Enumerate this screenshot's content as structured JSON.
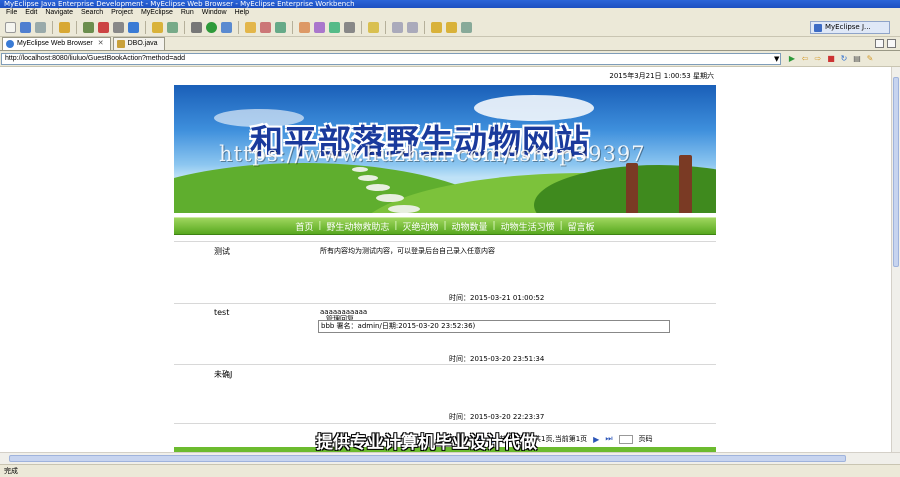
{
  "window": {
    "title": "MyEclipse Java Enterprise Development - MyEclipse Web Browser - MyEclipse Enterprise Workbench"
  },
  "menu": [
    "File",
    "Edit",
    "Navigate",
    "Search",
    "Project",
    "MyEclipse",
    "Run",
    "Window",
    "Help"
  ],
  "perspective": {
    "label": "MyEclipse J..."
  },
  "tabs": [
    {
      "label": "MyEclipse Web Browser",
      "active": true
    },
    {
      "label": "DBO.java",
      "active": false
    }
  ],
  "browser": {
    "url": "http://localhost:8080/liuluo/GuestBookAction?method=add",
    "datetime": "2015年3月21日  1:00:53  星期六"
  },
  "site": {
    "title": "和平部落野生动物网站",
    "watermark": "https://www.huzhan.com/ishop39397",
    "nav": [
      "首页",
      "野生动物救助志",
      "灭绝动物",
      "动物数量",
      "动物生活习惯",
      "留言板"
    ]
  },
  "entries": [
    {
      "name": "测试",
      "content": "所有内容均为测试内容，可以登录后台自己录入任意内容",
      "time": "时间：2015-03-21 01:00:52"
    },
    {
      "name": "test",
      "content": "aaaaaaaaaaa",
      "reply_title": "管理回复",
      "reply": "bbb  署名：admin/日期:2015-03-20 23:52:36)",
      "time": "时间：2015-03-20 23:51:34"
    },
    {
      "name": "未确J",
      "content": "",
      "time": "时间：2015-03-20 22:23:37"
    }
  ],
  "pager": {
    "summary": "共3条记录,共1页,当前第1页",
    "go_label": "页码",
    "first": "⏮",
    "prev": "◀",
    "next": "▶",
    "last": "⏭"
  },
  "subtitle": "提供专业计算机毕业设计代做",
  "status": {
    "text": "完成"
  },
  "colors": {
    "nav_green": "#58a81f",
    "title_blue": "#1a3a9c",
    "chrome": "#ece9d8"
  }
}
